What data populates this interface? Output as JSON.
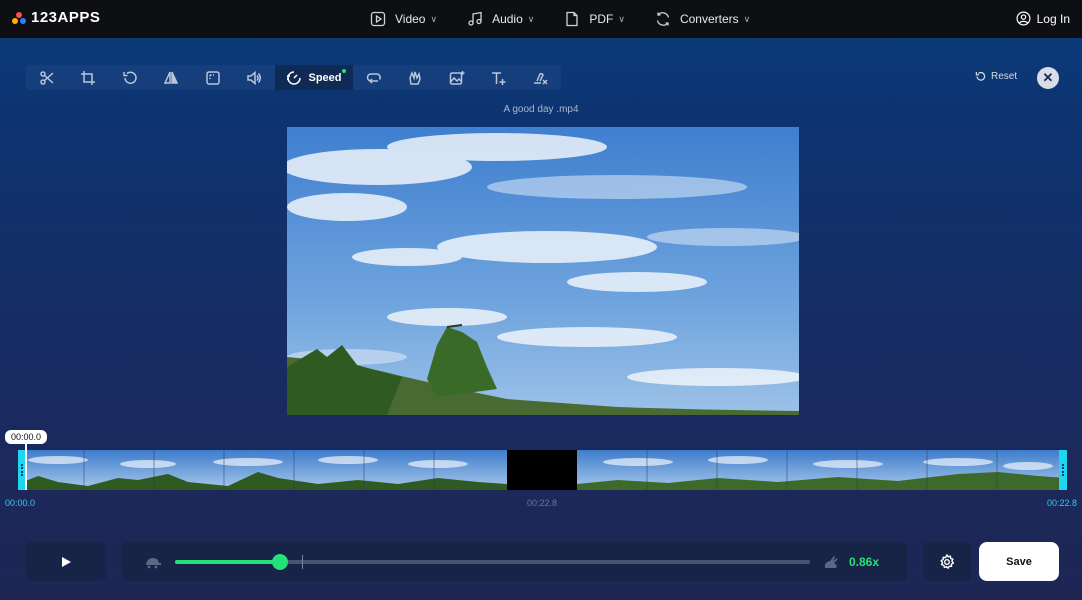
{
  "brand": {
    "name": "123APPS"
  },
  "nav": [
    {
      "label": "Video",
      "icon": "play-square-icon"
    },
    {
      "label": "Audio",
      "icon": "music-note-icon"
    },
    {
      "label": "PDF",
      "icon": "document-icon"
    },
    {
      "label": "Converters",
      "icon": "convert-arrows-icon"
    }
  ],
  "auth": {
    "login_label": "Log In"
  },
  "toolbar": {
    "speed_label": "Speed",
    "tools": [
      "scissors-icon",
      "crop-icon",
      "rotate-icon",
      "flip-icon",
      "resize-icon",
      "volume-icon",
      "speed-icon",
      "loop-icon",
      "stabilize-icon",
      "add-image-icon",
      "add-text-icon",
      "remove-logo-icon"
    ]
  },
  "actions": {
    "reset_label": "Reset",
    "save_label": "Save"
  },
  "video": {
    "filename": "A good day .mp4"
  },
  "timeline": {
    "current_tooltip": "00:00.0",
    "start_label": "00:00.0",
    "mid_label": "00:22.8",
    "end_label": "00:22.8"
  },
  "speed": {
    "value_label": "0.86x",
    "slider_fraction": 0.165,
    "default_fraction": 0.2
  },
  "colors": {
    "accent": "#27e07a",
    "handle": "#1fd6f0",
    "topbar": "#0e0f12"
  }
}
